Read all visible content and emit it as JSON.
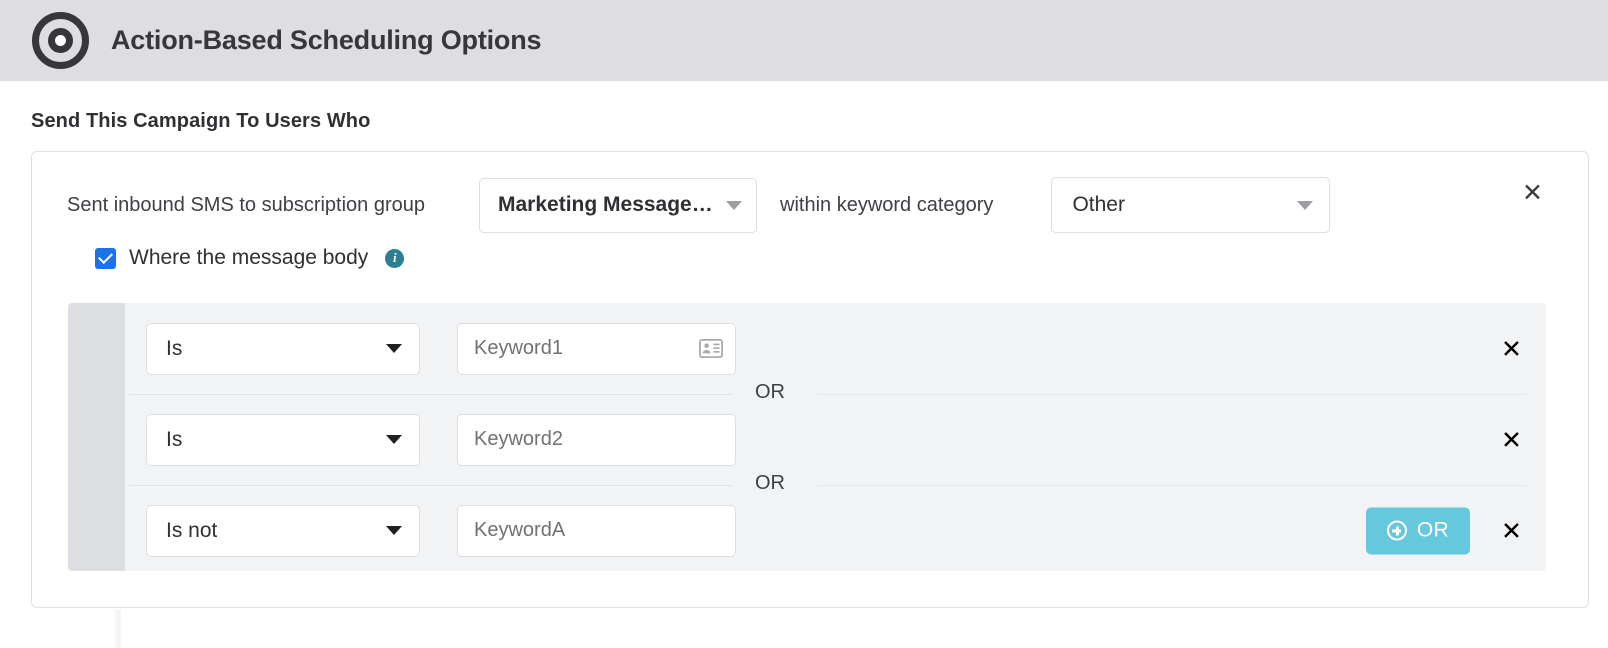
{
  "header": {
    "title": "Action-Based Scheduling Options",
    "icon": "target-icon"
  },
  "section": {
    "title": "Send This Campaign To Users Who"
  },
  "condition": {
    "label_1": "Sent inbound SMS to subscription group",
    "subscription_group": {
      "value": "Marketing Message…",
      "caret": "chevron-down-icon"
    },
    "label_2": "within keyword category",
    "keyword_category": {
      "value": "Other",
      "caret": "chevron-down-icon"
    },
    "close_label": "✕"
  },
  "message_body": {
    "checked": true,
    "label": "Where the message body",
    "info_label": "i"
  },
  "keyword_rows": [
    {
      "operator": "Is",
      "keyword_placeholder": "Keyword1",
      "has_contact_icon": true,
      "remove_label": "✕"
    },
    {
      "operator": "Is",
      "keyword_placeholder": "Keyword2",
      "has_contact_icon": false,
      "remove_label": "✕"
    },
    {
      "operator": "Is not",
      "keyword_placeholder": "KeywordA",
      "has_contact_icon": false,
      "remove_label": "✕"
    }
  ],
  "dividers": {
    "or_text": "OR"
  },
  "add_or_button": {
    "label": "OR",
    "icon": "plus-circle-icon"
  },
  "colors": {
    "header_bg": "#dedee2",
    "accent_teal": "#66c8dc",
    "checkbox_blue": "#1a73e8",
    "info_teal": "#2b7f92",
    "panel_bg": "#f2f3f5",
    "rail_bg": "#dddee1",
    "border": "#dcdfe3"
  }
}
